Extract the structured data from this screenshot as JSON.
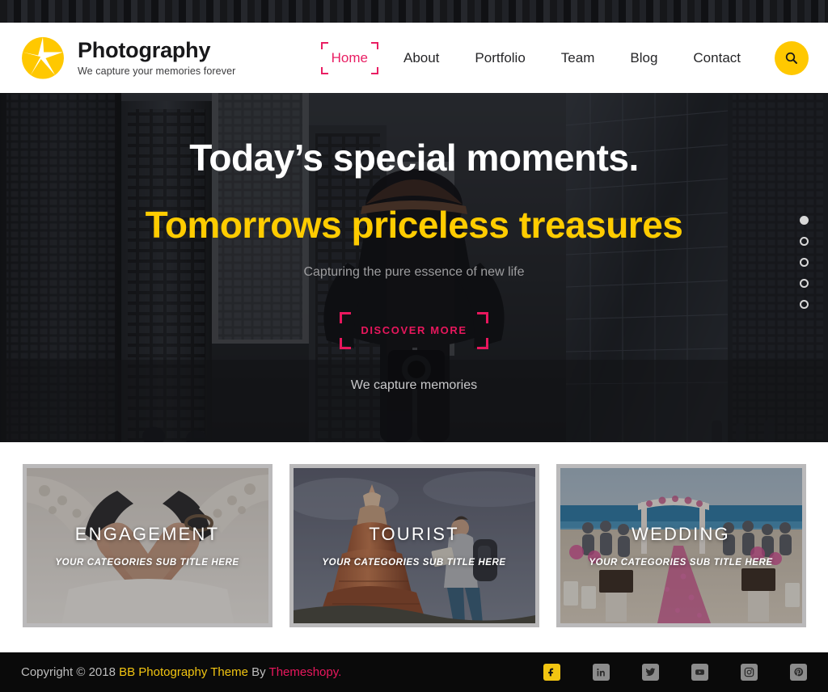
{
  "brand": {
    "title": "Photography",
    "tagline": "We capture your memories forever",
    "logo_icon": "aperture-icon",
    "logo_color": "#ffc800"
  },
  "nav": {
    "items": [
      {
        "label": "Home",
        "active": true
      },
      {
        "label": "About",
        "active": false
      },
      {
        "label": "Portfolio",
        "active": false
      },
      {
        "label": "Team",
        "active": false
      },
      {
        "label": "Blog",
        "active": false
      },
      {
        "label": "Contact",
        "active": false
      }
    ],
    "active_color": "#e91e63",
    "search_icon": "search-icon",
    "search_button_color": "#ffc800"
  },
  "hero": {
    "heading_line1": "Today’s special moments.",
    "heading_line2": "Tomorrows priceless treasures",
    "heading_line2_color": "#ffcc00",
    "subtitle": "Capturing the pure essence of new life",
    "cta_label": "DISCOVER MORE",
    "cta_color": "#e8175d",
    "caption": "We capture memories",
    "slider_dots": 5,
    "slider_active_index": 0
  },
  "categories": [
    {
      "title": "ENGAGEMENT",
      "subtitle": "YOUR CATEGORIES SUB TITLE HERE"
    },
    {
      "title": "TOURIST",
      "subtitle": "YOUR CATEGORIES SUB TITLE HERE"
    },
    {
      "title": "WEDDING",
      "subtitle": "YOUR CATEGORIES SUB TITLE HERE"
    }
  ],
  "footer": {
    "copyright_prefix": "Copyright © 2018 ",
    "theme_name": "BB Photography Theme",
    "by_text": " By ",
    "author": "Themeshopy.",
    "theme_color": "#f2c511",
    "author_color": "#e8175d",
    "socials": [
      {
        "name": "facebook",
        "glyph": "f",
        "active": true
      },
      {
        "name": "linkedin",
        "glyph": "in",
        "active": false
      },
      {
        "name": "twitter",
        "glyph": "twitter",
        "active": false
      },
      {
        "name": "youtube",
        "glyph": "youtube",
        "active": false
      },
      {
        "name": "instagram",
        "glyph": "instagram",
        "active": false
      },
      {
        "name": "pinterest",
        "glyph": "P",
        "active": false
      }
    ]
  }
}
